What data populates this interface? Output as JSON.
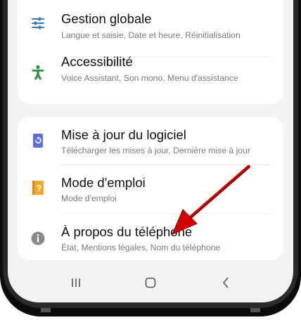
{
  "settings_group_1": [
    {
      "title": "Gestion globale",
      "subtitle": "Langue et saisie, Date et heure, Réinitialisation",
      "icon": "sliders-icon",
      "color": "#3a7fa8"
    },
    {
      "title": "Accessibilité",
      "subtitle": "Voice Assistant, Son mono, Menu d'assistance",
      "icon": "accessibility-person-icon",
      "color": "#2e8b3f"
    }
  ],
  "settings_group_2": [
    {
      "title": "Mise à jour du logiciel",
      "subtitle": "Télécharger les mises à jour, Dernière mise à jour",
      "icon": "software-update-icon",
      "color": "#5b6fd6"
    },
    {
      "title": "Mode d'emploi",
      "subtitle": "Mode d'emploi",
      "icon": "user-manual-icon",
      "color": "#f0a830"
    },
    {
      "title": "À propos du téléphone",
      "subtitle": "État, Mentions légales, Nom du téléphone",
      "icon": "info-icon",
      "color": "#888888"
    }
  ],
  "navbar": {
    "recents": "recents-icon",
    "home": "home-icon",
    "back": "back-icon"
  },
  "annotation": {
    "arrow_color": "#d40000"
  }
}
